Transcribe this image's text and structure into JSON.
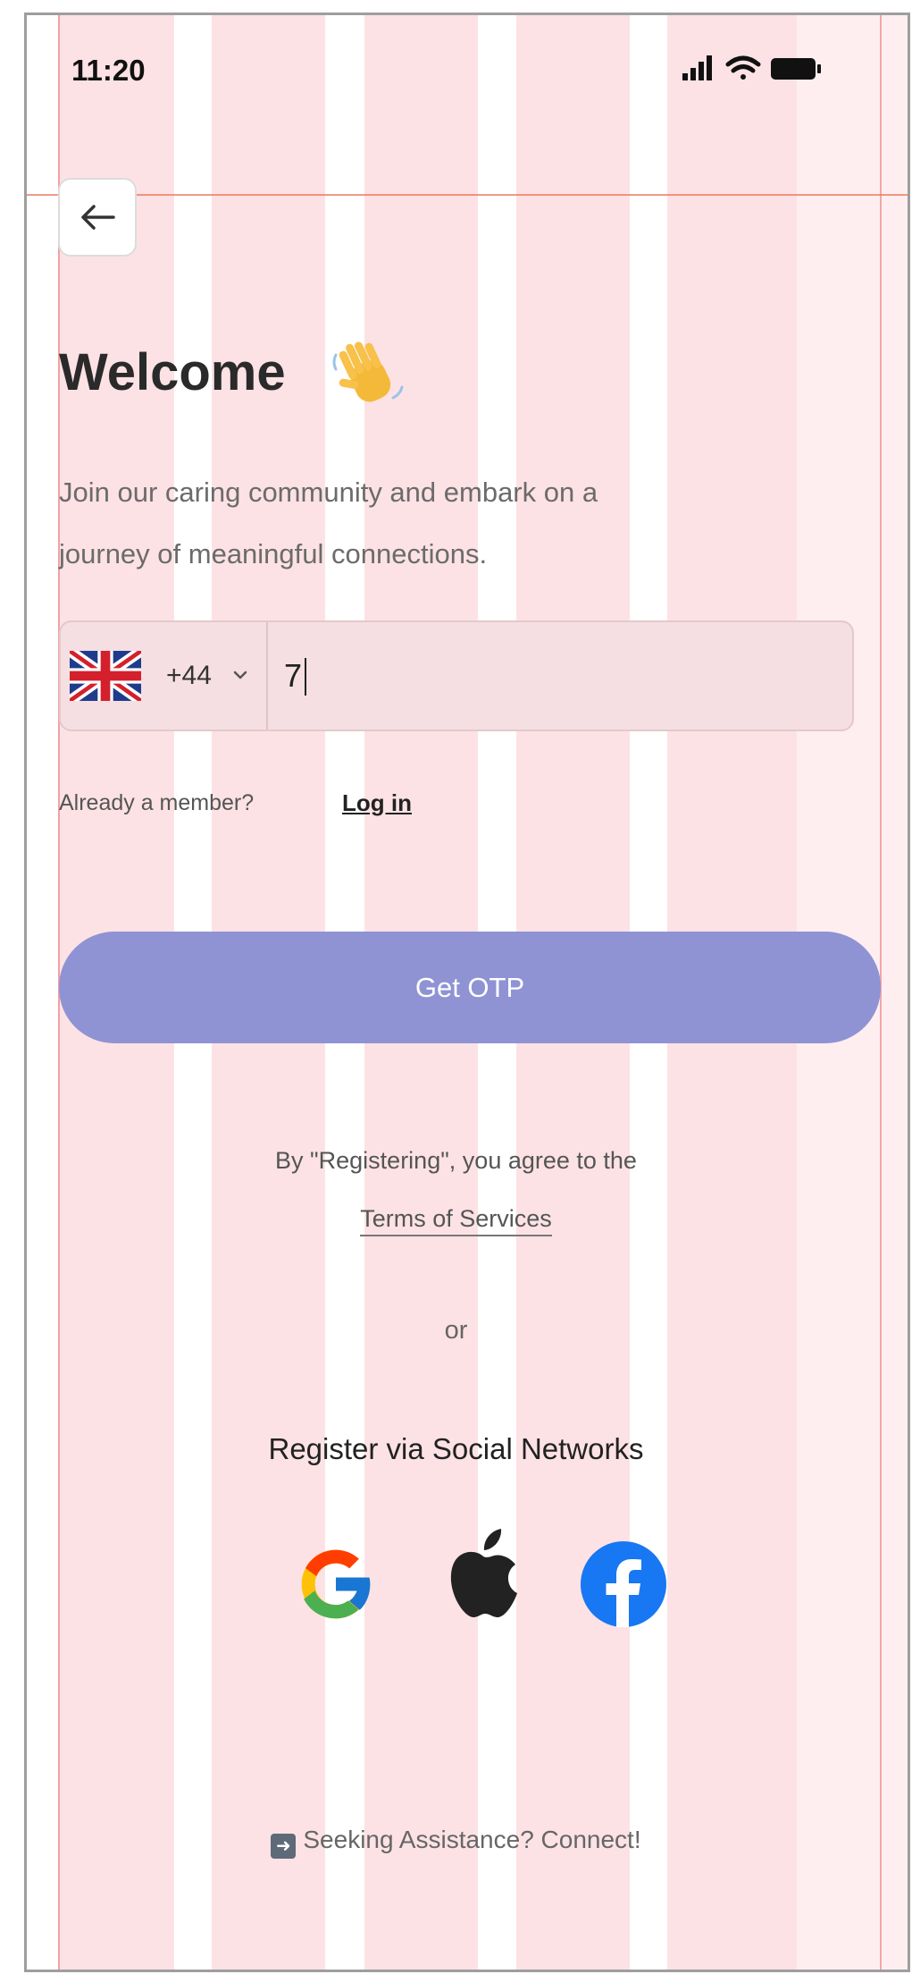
{
  "status_bar": {
    "time": "11:20"
  },
  "header": {
    "title": "Welcome",
    "title_emoji": "👋"
  },
  "subtitle": {
    "line1": "Join our caring community and embark on a",
    "line2": "journey of meaningful connections."
  },
  "phone": {
    "country_code": "+44",
    "value": "7"
  },
  "member": {
    "text": "Already a member?",
    "login_label": "Log in"
  },
  "primary_button": {
    "label": "Get OTP"
  },
  "legal": {
    "agree_text": "By \"Registering\", you agree to the",
    "terms_label": "Terms of Services"
  },
  "divider": {
    "or_text": "or"
  },
  "social": {
    "title": "Register via Social Networks",
    "providers": [
      "google-icon",
      "apple-icon",
      "facebook-icon"
    ]
  },
  "assistance": {
    "icon": "arrow-right-box-icon",
    "label": "Seeking Assistance? Connect!"
  },
  "colors": {
    "primary_button": "#8f93d4",
    "grid_overlay": "#f8a0aa",
    "facebook_blue": "#1877f2"
  }
}
